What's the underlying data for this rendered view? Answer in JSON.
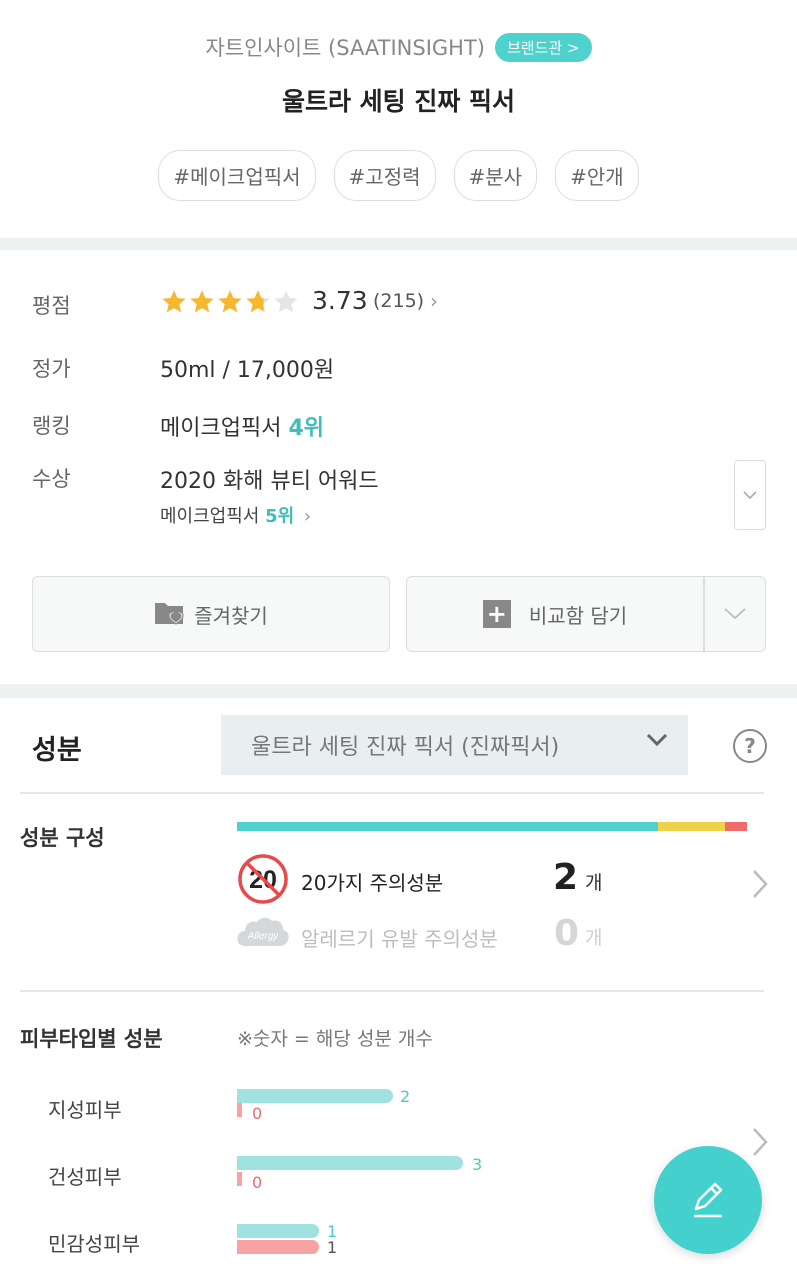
{
  "header": {
    "brand_name": "자트인사이트 (SAATINSIGHT)",
    "brand_badge": "브랜드관 >",
    "product_title": "울트라 세팅 진짜 픽서",
    "tags": [
      "#메이크업픽서",
      "#고정력",
      "#분사",
      "#안개"
    ]
  },
  "info": {
    "rating_label": "평점",
    "rating_value": "3.73",
    "rating_count": "(215)",
    "rating_stars": 3.73,
    "price_label": "정가",
    "price_value": "50ml / 17,000원",
    "ranking_label": "랭킹",
    "ranking_category": "메이크업픽서",
    "ranking_rank": "4위",
    "award_label": "수상",
    "award_title": "2020 화해 뷰티 어워드",
    "award_category": "메이크업픽서",
    "award_rank": "5위"
  },
  "actions": {
    "favorite_label": "즐겨찾기",
    "compare_label": "비교함 담기"
  },
  "ingredients": {
    "title": "성분",
    "selected_product": "울트라 세팅 진짜 픽서 (진짜픽서)",
    "help": "?",
    "composition_title": "성분 구성",
    "composition_bar": {
      "green": 0.826,
      "yellow": 0.13,
      "red": 0.044
    },
    "caution20_badge": "20",
    "caution20_label": "20가지 주의성분",
    "caution20_count": "2",
    "allergy_badge": "Allergy",
    "allergy_label": "알레르기 유발 주의성분",
    "allergy_count": "0",
    "unit": "개",
    "skin_title": "피부타입별 성분",
    "skin_note": "※숫자 = 해당 성분 개수",
    "skin_types": [
      {
        "label": "지성피부",
        "good": "2",
        "bad": "0"
      },
      {
        "label": "건성피부",
        "good": "3",
        "bad": "0"
      },
      {
        "label": "민감성피부",
        "good": "1",
        "bad": "1"
      }
    ]
  },
  "colors": {
    "accent": "#44d0cc",
    "bar_green": "#4fd1cd",
    "bar_yellow": "#f0d24a",
    "bar_red": "#f06a6a",
    "star": "#f7b731"
  }
}
